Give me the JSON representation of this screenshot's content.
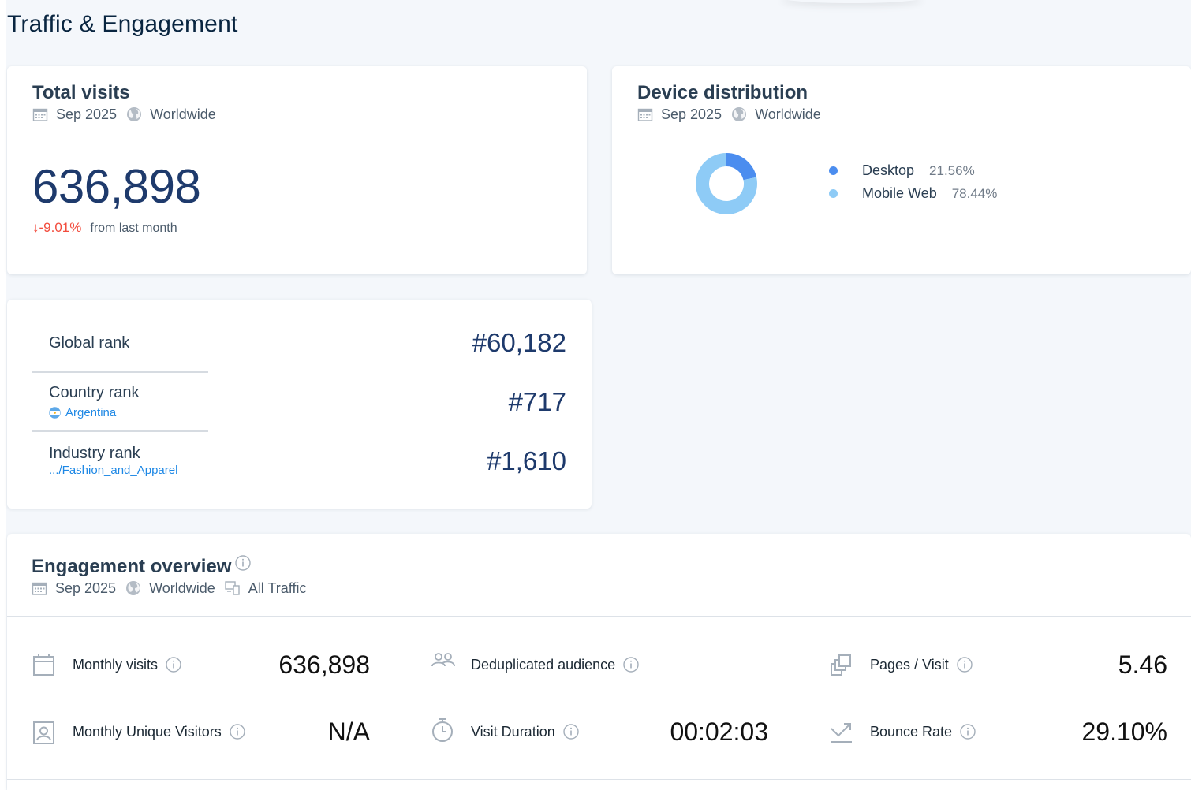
{
  "page": {
    "title": "Traffic & Engagement"
  },
  "total_visits": {
    "title": "Total visits",
    "date": "Sep 2025",
    "region": "Worldwide",
    "value": "636,898",
    "change": "↓-9.01%",
    "change_suffix": "from last month"
  },
  "device_distribution": {
    "title": "Device distribution",
    "date": "Sep 2025",
    "region": "Worldwide",
    "items": [
      {
        "name": "Desktop",
        "value": "21.56%",
        "share": 21.56,
        "color": "#4b8def"
      },
      {
        "name": "Mobile Web",
        "value": "78.44%",
        "share": 78.44,
        "color": "#8ecbf6"
      }
    ]
  },
  "ranks": {
    "global": {
      "label": "Global rank",
      "value": "#60,182"
    },
    "country": {
      "label": "Country rank",
      "sub": "Argentina",
      "value": "#717"
    },
    "industry": {
      "label": "Industry rank",
      "sub": ".../Fashion_and_Apparel",
      "value": "#1,610"
    }
  },
  "engagement": {
    "title": "Engagement overview",
    "date": "Sep 2025",
    "region": "Worldwide",
    "traffic": "All Traffic",
    "metrics": {
      "monthly_visits": {
        "label": "Monthly visits",
        "value": "636,898",
        "icon": "calendar-icon"
      },
      "unique_visitors": {
        "label": "Monthly Unique Visitors",
        "value": "N/A",
        "icon": "person-badge-icon"
      },
      "dedup_audience": {
        "label": "Deduplicated audience",
        "value": "",
        "icon": "people-icon"
      },
      "visit_duration": {
        "label": "Visit Duration",
        "value": "00:02:03",
        "icon": "stopwatch-icon"
      },
      "pages_visit": {
        "label": "Pages / Visit",
        "value": "5.46",
        "icon": "pages-icon"
      },
      "bounce_rate": {
        "label": "Bounce Rate",
        "value": "29.10%",
        "icon": "bounce-arrow-icon"
      }
    }
  },
  "colors": {
    "accent_dark": "#1e3a6c",
    "negative": "#f24c3d",
    "link": "#1e88e5",
    "background": "#f4f7fb"
  }
}
